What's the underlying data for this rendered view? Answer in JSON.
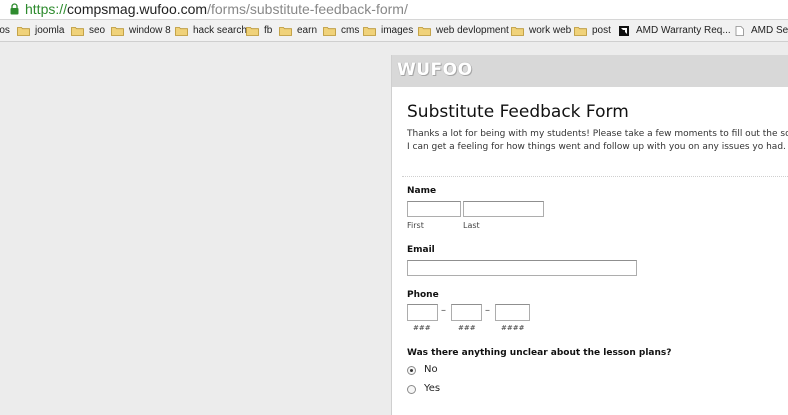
{
  "address_bar": {
    "url_scheme": "https://",
    "url_host": "compsmag.wufoo.com",
    "url_path": "/forms/substitute-feedback-form/"
  },
  "bookmarks": [
    {
      "label": "ros",
      "icon": "folder-icon"
    },
    {
      "label": "joomla",
      "icon": "folder-icon"
    },
    {
      "label": "seo",
      "icon": "folder-icon"
    },
    {
      "label": "window 8",
      "icon": "folder-icon"
    },
    {
      "label": "hack search",
      "icon": "folder-icon"
    },
    {
      "label": "fb",
      "icon": "folder-icon"
    },
    {
      "label": "earn",
      "icon": "folder-icon"
    },
    {
      "label": "cms",
      "icon": "folder-icon"
    },
    {
      "label": "images",
      "icon": "folder-icon"
    },
    {
      "label": "web devlopment",
      "icon": "folder-icon"
    },
    {
      "label": "work web",
      "icon": "folder-icon"
    },
    {
      "label": "post",
      "icon": "folder-icon"
    },
    {
      "label": "AMD Warranty Req...",
      "icon": "amd-icon"
    },
    {
      "label": "AMD Serv",
      "icon": "page-icon"
    }
  ],
  "form": {
    "logo": "WUFOO",
    "title": "Substitute Feedback Form",
    "description": "Thanks a lot for being with my students! Please take a few moments to fill out the so I can get a feeling for how things went and follow up with you on any issues yo had.",
    "name": {
      "label": "Name",
      "first": "First",
      "last": "Last"
    },
    "email": {
      "label": "Email"
    },
    "phone": {
      "label": "Phone",
      "area_hint": "###",
      "prefix_hint": "###",
      "line_hint": "####"
    },
    "question": {
      "label": "Was there anything unclear about the lesson plans?",
      "options": [
        {
          "label": "No",
          "selected": true
        },
        {
          "label": "Yes",
          "selected": false
        }
      ]
    }
  }
}
